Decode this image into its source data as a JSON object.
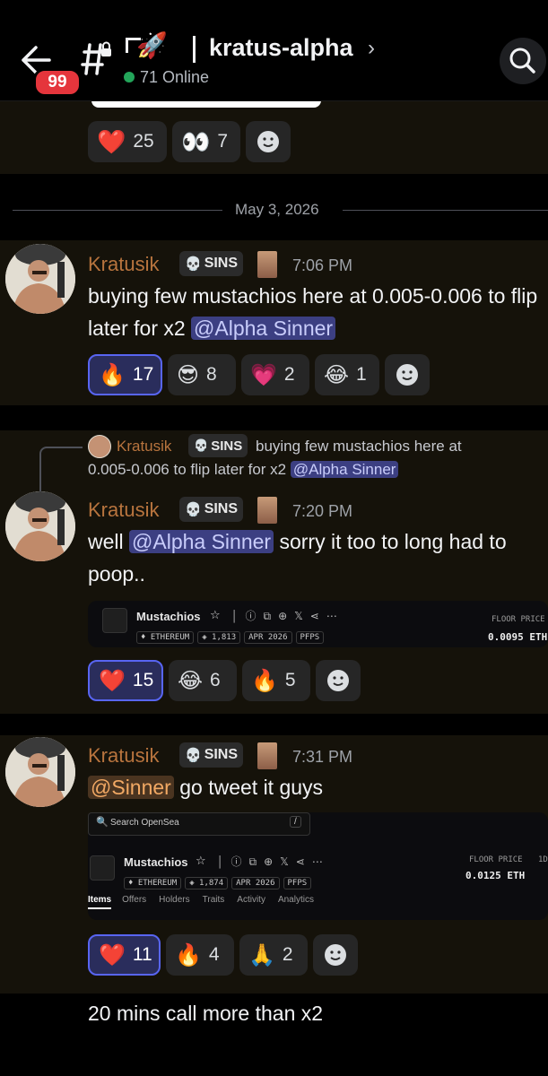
{
  "header": {
    "unread_count": "99",
    "channel_name": "kratus-alpha",
    "online": "71 Online"
  },
  "top_reactions": [
    {
      "emoji": "❤️",
      "count": "25"
    },
    {
      "emoji": "👀",
      "count": "7"
    }
  ],
  "date_divider": "May 3, 2026",
  "messages": [
    {
      "username": "Kratusik",
      "tag": "SINS",
      "time": "7:06 PM",
      "text_before": "buying few mustachios here at 0.005-0.006 to flip later for x2 ",
      "mention": "@Alpha Sinner",
      "reactions": [
        {
          "emoji": "🔥",
          "count": "17"
        },
        {
          "emoji": "😎",
          "count": "8"
        },
        {
          "emoji": "💗",
          "count": "2"
        },
        {
          "emoji": "😂",
          "count": "1"
        }
      ]
    },
    {
      "reply_username": "Kratusik",
      "reply_tag": "SINS",
      "reply_text_line1": "buying few mustachios here at",
      "reply_text_line2": "0.005-0.006 to flip later for x2 ",
      "reply_mention": "@Alpha Sinner",
      "username": "Kratusik",
      "tag": "SINS",
      "time": "7:20 PM",
      "text_prefix": "well ",
      "mention": "@Alpha Sinner",
      "text_suffix": " sorry it too to long had to",
      "text_line2": "poop..",
      "embed": {
        "name": "Mustachios",
        "chain": "ETHEREUM",
        "items": "1,813",
        "date": "APR 2026",
        "category": "PFPS",
        "floor_label": "FLOOR PRICE",
        "floor_value": "0.0095 ETH"
      },
      "reactions": [
        {
          "emoji": "❤️",
          "count": "15"
        },
        {
          "emoji": "😂",
          "count": "6"
        },
        {
          "emoji": "🔥",
          "count": "5"
        }
      ]
    },
    {
      "username": "Kratusik",
      "tag": "SINS",
      "time": "7:31 PM",
      "mention": "@Sinner",
      "text_suffix": " go tweet it guys",
      "embed": {
        "search": "Search OpenSea",
        "search_key": "/",
        "name": "Mustachios",
        "chain": "ETHEREUM",
        "items": "1,874",
        "date": "APR 2026",
        "category": "PFPS",
        "floor_label": "FLOOR PRICE",
        "floor_value": "0.0125 ETH",
        "extra_col": "1D",
        "tabs": [
          "Items",
          "Offers",
          "Holders",
          "Traits",
          "Activity",
          "Analytics"
        ]
      },
      "reactions": [
        {
          "emoji": "❤️",
          "count": "11"
        },
        {
          "emoji": "🔥",
          "count": "4"
        },
        {
          "emoji": "🙏",
          "count": "2"
        }
      ]
    }
  ],
  "last_message": "20 mins call more than x2",
  "colors": {
    "accent": "#5865f2",
    "username": "#b8743e",
    "online": "#23a55a",
    "badge": "#e5353c"
  }
}
